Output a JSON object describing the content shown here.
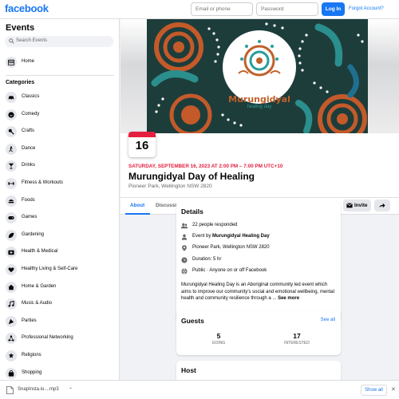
{
  "topbar": {
    "logo": "facebook",
    "email_placeholder": "Email or phone",
    "password_placeholder": "Password",
    "login_label": "Log In",
    "forgot_label": "Forgot Account?"
  },
  "sidebar": {
    "title": "Events",
    "search_placeholder": "Search Events",
    "home_label": "Home",
    "categories_title": "Categories",
    "categories": [
      {
        "label": "Classics",
        "icon": "car-icon"
      },
      {
        "label": "Comedy",
        "icon": "laugh-icon"
      },
      {
        "label": "Crafts",
        "icon": "crafts-icon"
      },
      {
        "label": "Dance",
        "icon": "dance-icon"
      },
      {
        "label": "Drinks",
        "icon": "cocktail-icon"
      },
      {
        "label": "Fitness & Workouts",
        "icon": "dumbbell-icon"
      },
      {
        "label": "Foods",
        "icon": "food-icon"
      },
      {
        "label": "Games",
        "icon": "gamepad-icon"
      },
      {
        "label": "Gardening",
        "icon": "leaf-icon"
      },
      {
        "label": "Health & Medical",
        "icon": "medical-icon"
      },
      {
        "label": "Healthy Living & Self-Care",
        "icon": "heart-icon"
      },
      {
        "label": "Home & Garden",
        "icon": "house-icon"
      },
      {
        "label": "Music & Audio",
        "icon": "music-icon"
      },
      {
        "label": "Parties",
        "icon": "party-icon"
      },
      {
        "label": "Professional Networking",
        "icon": "network-icon"
      },
      {
        "label": "Religions",
        "icon": "religion-icon"
      },
      {
        "label": "Shopping",
        "icon": "bag-icon"
      }
    ]
  },
  "event": {
    "banner_line1": "Murungidyal",
    "banner_line2": "healing day",
    "date_day": "16",
    "when": "SATURDAY, SEPTEMBER 16, 2023 AT 2:00 PM – 7:00 PM UTC+10",
    "title": "Murungidyal Day of Healing",
    "location": "Pioneer Park, Wellington NSW 2820"
  },
  "tabs": {
    "about": "About",
    "discussion": "Discussion",
    "invite": "Invite"
  },
  "details": {
    "heading": "Details",
    "responded": "22 people responded",
    "event_by_prefix": "Event by ",
    "event_by": "Murungidyal Healing Day",
    "place": "Pioneer Park, Wellington NSW 2820",
    "duration": "Duration: 5 hr",
    "privacy": "Public · Anyone on or off Facebook",
    "description": "Murungidyal Healing Day is an Aboriginal community led event which aims to improve our community's social and emotional wellbeing, mental health and community resilience through a ...",
    "see_more": "See more"
  },
  "guests": {
    "heading": "Guests",
    "see_all": "See all",
    "going_count": "5",
    "going_label": "GOING",
    "interested_count": "17",
    "interested_label": "INTERESTED"
  },
  "host": {
    "heading": "Host"
  },
  "download": {
    "filename": "SnapInsta.io....mp3",
    "show_all": "Show all"
  },
  "colors": {
    "brand": "#1877f2",
    "accent_red": "#e41e3f",
    "banner_bg": "#1d3d3b"
  }
}
